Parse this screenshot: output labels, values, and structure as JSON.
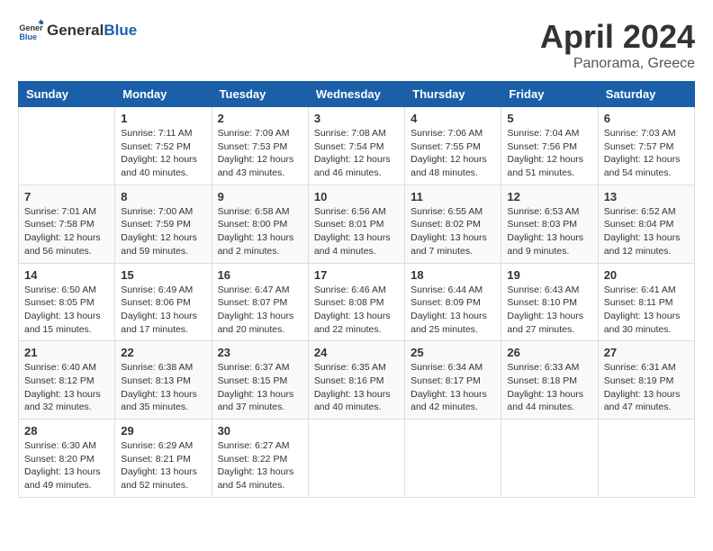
{
  "header": {
    "logo_general": "General",
    "logo_blue": "Blue",
    "month": "April 2024",
    "location": "Panorama, Greece"
  },
  "weekdays": [
    "Sunday",
    "Monday",
    "Tuesday",
    "Wednesday",
    "Thursday",
    "Friday",
    "Saturday"
  ],
  "weeks": [
    [
      {
        "day": "",
        "sunrise": "",
        "sunset": "",
        "daylight": ""
      },
      {
        "day": "1",
        "sunrise": "Sunrise: 7:11 AM",
        "sunset": "Sunset: 7:52 PM",
        "daylight": "Daylight: 12 hours and 40 minutes."
      },
      {
        "day": "2",
        "sunrise": "Sunrise: 7:09 AM",
        "sunset": "Sunset: 7:53 PM",
        "daylight": "Daylight: 12 hours and 43 minutes."
      },
      {
        "day": "3",
        "sunrise": "Sunrise: 7:08 AM",
        "sunset": "Sunset: 7:54 PM",
        "daylight": "Daylight: 12 hours and 46 minutes."
      },
      {
        "day": "4",
        "sunrise": "Sunrise: 7:06 AM",
        "sunset": "Sunset: 7:55 PM",
        "daylight": "Daylight: 12 hours and 48 minutes."
      },
      {
        "day": "5",
        "sunrise": "Sunrise: 7:04 AM",
        "sunset": "Sunset: 7:56 PM",
        "daylight": "Daylight: 12 hours and 51 minutes."
      },
      {
        "day": "6",
        "sunrise": "Sunrise: 7:03 AM",
        "sunset": "Sunset: 7:57 PM",
        "daylight": "Daylight: 12 hours and 54 minutes."
      }
    ],
    [
      {
        "day": "7",
        "sunrise": "Sunrise: 7:01 AM",
        "sunset": "Sunset: 7:58 PM",
        "daylight": "Daylight: 12 hours and 56 minutes."
      },
      {
        "day": "8",
        "sunrise": "Sunrise: 7:00 AM",
        "sunset": "Sunset: 7:59 PM",
        "daylight": "Daylight: 12 hours and 59 minutes."
      },
      {
        "day": "9",
        "sunrise": "Sunrise: 6:58 AM",
        "sunset": "Sunset: 8:00 PM",
        "daylight": "Daylight: 13 hours and 2 minutes."
      },
      {
        "day": "10",
        "sunrise": "Sunrise: 6:56 AM",
        "sunset": "Sunset: 8:01 PM",
        "daylight": "Daylight: 13 hours and 4 minutes."
      },
      {
        "day": "11",
        "sunrise": "Sunrise: 6:55 AM",
        "sunset": "Sunset: 8:02 PM",
        "daylight": "Daylight: 13 hours and 7 minutes."
      },
      {
        "day": "12",
        "sunrise": "Sunrise: 6:53 AM",
        "sunset": "Sunset: 8:03 PM",
        "daylight": "Daylight: 13 hours and 9 minutes."
      },
      {
        "day": "13",
        "sunrise": "Sunrise: 6:52 AM",
        "sunset": "Sunset: 8:04 PM",
        "daylight": "Daylight: 13 hours and 12 minutes."
      }
    ],
    [
      {
        "day": "14",
        "sunrise": "Sunrise: 6:50 AM",
        "sunset": "Sunset: 8:05 PM",
        "daylight": "Daylight: 13 hours and 15 minutes."
      },
      {
        "day": "15",
        "sunrise": "Sunrise: 6:49 AM",
        "sunset": "Sunset: 8:06 PM",
        "daylight": "Daylight: 13 hours and 17 minutes."
      },
      {
        "day": "16",
        "sunrise": "Sunrise: 6:47 AM",
        "sunset": "Sunset: 8:07 PM",
        "daylight": "Daylight: 13 hours and 20 minutes."
      },
      {
        "day": "17",
        "sunrise": "Sunrise: 6:46 AM",
        "sunset": "Sunset: 8:08 PM",
        "daylight": "Daylight: 13 hours and 22 minutes."
      },
      {
        "day": "18",
        "sunrise": "Sunrise: 6:44 AM",
        "sunset": "Sunset: 8:09 PM",
        "daylight": "Daylight: 13 hours and 25 minutes."
      },
      {
        "day": "19",
        "sunrise": "Sunrise: 6:43 AM",
        "sunset": "Sunset: 8:10 PM",
        "daylight": "Daylight: 13 hours and 27 minutes."
      },
      {
        "day": "20",
        "sunrise": "Sunrise: 6:41 AM",
        "sunset": "Sunset: 8:11 PM",
        "daylight": "Daylight: 13 hours and 30 minutes."
      }
    ],
    [
      {
        "day": "21",
        "sunrise": "Sunrise: 6:40 AM",
        "sunset": "Sunset: 8:12 PM",
        "daylight": "Daylight: 13 hours and 32 minutes."
      },
      {
        "day": "22",
        "sunrise": "Sunrise: 6:38 AM",
        "sunset": "Sunset: 8:13 PM",
        "daylight": "Daylight: 13 hours and 35 minutes."
      },
      {
        "day": "23",
        "sunrise": "Sunrise: 6:37 AM",
        "sunset": "Sunset: 8:15 PM",
        "daylight": "Daylight: 13 hours and 37 minutes."
      },
      {
        "day": "24",
        "sunrise": "Sunrise: 6:35 AM",
        "sunset": "Sunset: 8:16 PM",
        "daylight": "Daylight: 13 hours and 40 minutes."
      },
      {
        "day": "25",
        "sunrise": "Sunrise: 6:34 AM",
        "sunset": "Sunset: 8:17 PM",
        "daylight": "Daylight: 13 hours and 42 minutes."
      },
      {
        "day": "26",
        "sunrise": "Sunrise: 6:33 AM",
        "sunset": "Sunset: 8:18 PM",
        "daylight": "Daylight: 13 hours and 44 minutes."
      },
      {
        "day": "27",
        "sunrise": "Sunrise: 6:31 AM",
        "sunset": "Sunset: 8:19 PM",
        "daylight": "Daylight: 13 hours and 47 minutes."
      }
    ],
    [
      {
        "day": "28",
        "sunrise": "Sunrise: 6:30 AM",
        "sunset": "Sunset: 8:20 PM",
        "daylight": "Daylight: 13 hours and 49 minutes."
      },
      {
        "day": "29",
        "sunrise": "Sunrise: 6:29 AM",
        "sunset": "Sunset: 8:21 PM",
        "daylight": "Daylight: 13 hours and 52 minutes."
      },
      {
        "day": "30",
        "sunrise": "Sunrise: 6:27 AM",
        "sunset": "Sunset: 8:22 PM",
        "daylight": "Daylight: 13 hours and 54 minutes."
      },
      {
        "day": "",
        "sunrise": "",
        "sunset": "",
        "daylight": ""
      },
      {
        "day": "",
        "sunrise": "",
        "sunset": "",
        "daylight": ""
      },
      {
        "day": "",
        "sunrise": "",
        "sunset": "",
        "daylight": ""
      },
      {
        "day": "",
        "sunrise": "",
        "sunset": "",
        "daylight": ""
      }
    ]
  ]
}
